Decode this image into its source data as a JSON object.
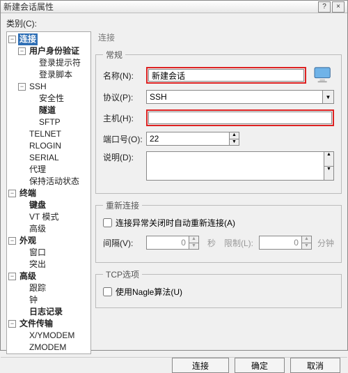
{
  "window": {
    "title": "新建会话属性",
    "help": "?",
    "close": "×"
  },
  "category_label": "类别(C):",
  "tree": {
    "n0": "连接",
    "n0_0": "用户身份验证",
    "n0_0_0": "登录提示符",
    "n0_0_1": "登录脚本",
    "n0_1": "SSH",
    "n0_1_0": "安全性",
    "n0_1_1": "隧道",
    "n0_1_2": "SFTP",
    "n0_2": "TELNET",
    "n0_3": "RLOGIN",
    "n0_4": "SERIAL",
    "n0_5": "代理",
    "n0_6": "保持活动状态",
    "n1": "终端",
    "n1_0": "键盘",
    "n1_1": "VT 模式",
    "n1_2": "高级",
    "n2": "外观",
    "n2_0": "窗口",
    "n2_1": "突出",
    "n3": "高级",
    "n3_0": "跟踪",
    "n3_1": "钟",
    "n3_2": "日志记录",
    "n4": "文件传输",
    "n4_0": "X/YMODEM",
    "n4_1": "ZMODEM"
  },
  "content": {
    "heading": "连接",
    "group_general": "常规",
    "name_label": "名称(N):",
    "name_value": "新建会话",
    "proto_label": "协议(P):",
    "proto_value": "SSH",
    "host_label": "主机(H):",
    "host_value": "",
    "port_label": "端口号(O):",
    "port_value": "22",
    "desc_label": "说明(D):",
    "group_reconnect": "重新连接",
    "reconnect_cb": "连接异常关闭时自动重新连接(A)",
    "interval_label": "间隔(V):",
    "interval_value": "0",
    "interval_unit": "秒",
    "limit_label": "限制(L):",
    "limit_value": "0",
    "limit_unit": "分钟",
    "group_tcp": "TCP选项",
    "nagle_cb": "使用Nagle算法(U)"
  },
  "footer": {
    "connect": "连接",
    "ok": "确定",
    "cancel": "取消"
  }
}
